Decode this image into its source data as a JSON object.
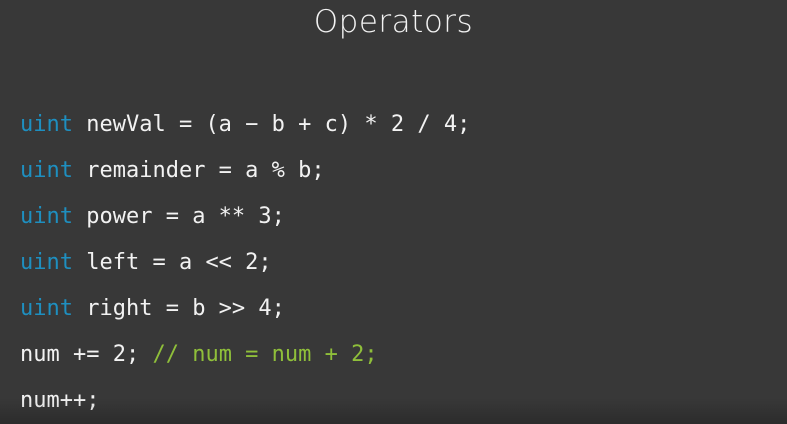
{
  "slide": {
    "title": "Operators",
    "code_lines": [
      {
        "keyword": "uint",
        "code": "newVal = (a − b + c) * 2 / 4;",
        "comment": ""
      },
      {
        "keyword": "uint",
        "code": "remainder = a % b;",
        "comment": ""
      },
      {
        "keyword": "uint",
        "code": "power = a ** 3;",
        "comment": ""
      },
      {
        "keyword": "uint",
        "code": "left = a << 2;",
        "comment": ""
      },
      {
        "keyword": "uint",
        "code": "right = b >> 4;",
        "comment": ""
      },
      {
        "keyword": "",
        "code": "num += 2;",
        "comment": "// num = num + 2;"
      },
      {
        "keyword": "",
        "code": "num++;",
        "comment": ""
      }
    ]
  },
  "colors": {
    "background": "#383838",
    "text": "#f2f2f2",
    "keyword": "#1e8fc0",
    "comment": "#8fbf3a"
  }
}
